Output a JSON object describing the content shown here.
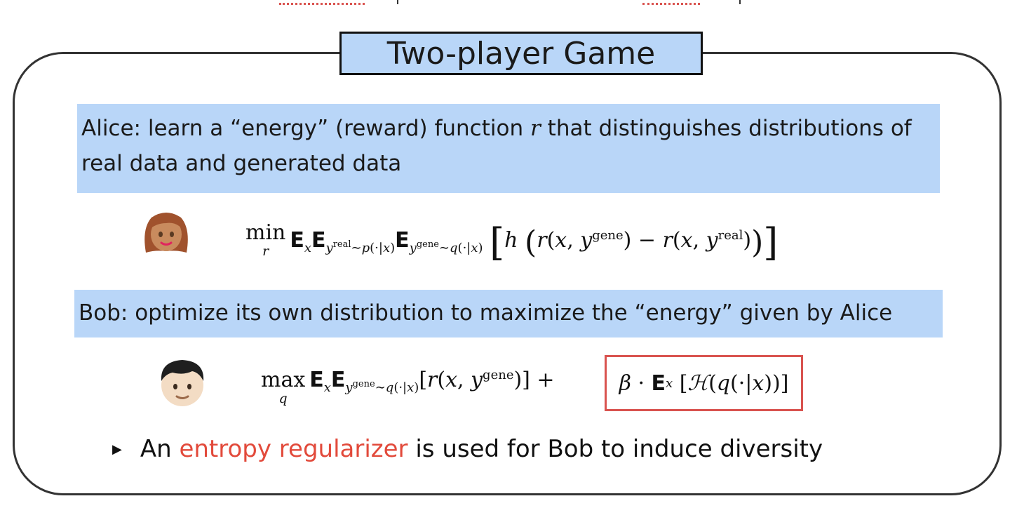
{
  "title": "Two-player Game",
  "alice": {
    "description_1": "Alice: learn a “energy” (reward) function",
    "description_var": "r",
    "description_2": "that distinguishes distributions of real data and generated data",
    "avatar_icon": "girl-face-icon"
  },
  "bob": {
    "description": "Bob: optimize its own distribution to maximize the “energy” given by Alice",
    "avatar_icon": "boy-face-icon"
  },
  "bullet": {
    "prefix": "An",
    "highlight": "entropy regularizer",
    "suffix": "is used for Bob to induce diversity"
  },
  "colors": {
    "band": "#b9d6f8",
    "accent": "#e24a3b",
    "border": "#333333"
  }
}
